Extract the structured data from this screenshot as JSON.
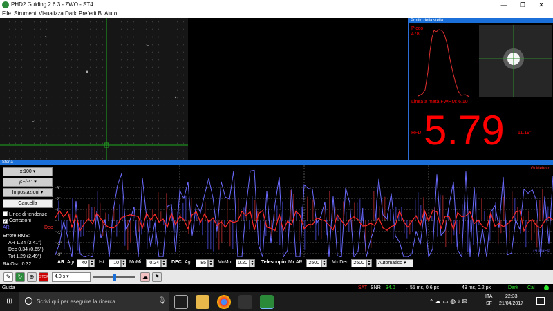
{
  "window": {
    "title": "PHD2 Guiding 2.6.3 - ZWO - ST4",
    "minimize": "—",
    "maximize": "❐",
    "close": "✕"
  },
  "menu": [
    "File",
    "Strumenti",
    "Visualizza",
    "Dark",
    "PreferitiB",
    "Aiuto"
  ],
  "profile": {
    "header": "Profilo della stella",
    "peak_label": "Picco",
    "peak_value": "478",
    "fwhm": "Linea a metà FWHM: 6.10",
    "hfd_label": "HFD",
    "hfd_value": "5.79",
    "hfd_arcsec": "11.19\"",
    "colors": {
      "text": "#ff0000",
      "curve": "#e03030"
    }
  },
  "history": {
    "header": "Storia",
    "x_scale": "x:100",
    "y_scale": "y:+/-4\"",
    "settings": "Impostazioni",
    "cancel": "Cancella",
    "trend_lines": "Linee di tendenze",
    "corrections": "Correzioni",
    "ar_label": "AR",
    "dec_label": "Dec",
    "rms_title": "Errore RMS:",
    "rms_ar": "AR 1.24 (2.41\")",
    "rms_dec": "Dec 0.34 (0.65\")",
    "rms_tot": "Tot 1.29 (2.49\")",
    "ra_osc": "RA Osc: 0.32",
    "legend_right_top": "Guidehord",
    "legend_right_bottom": "GuidaEst",
    "y_ticks": [
      "3\"",
      "2\"",
      "1\"",
      "-1\"",
      "-2\"",
      "-3\""
    ],
    "colors": {
      "ra": "#6b6bff",
      "dec": "#ff2a2a"
    }
  },
  "params": {
    "ar": "AR:",
    "agr": "Agr",
    "agr_val": "40",
    "ist": "Ist",
    "ist_val": "10",
    "momi": "MoMi",
    "momi_val": "0.24",
    "dec": "DEC:",
    "dec_agr": "Agr",
    "dec_agr_val": "85",
    "mnmo": "MnMo",
    "mnmo_val": "0.20",
    "tel": "Telescopio:",
    "mxar": "Mx AR",
    "mxar_val": "2500",
    "mxdec": "Mx Dec",
    "mxdec_val": "2500",
    "mode": "Automatico"
  },
  "toolbar": {
    "exposure": "4.0 s"
  },
  "status": {
    "guiding": "Guida",
    "sat": "SAT",
    "snr_label": "SNR",
    "snr_value": "34.0",
    "ra_pulse": "55 ms, 0.6 px",
    "dec_pulse": "49 ms, 0.2 px",
    "dark": "Dark",
    "cal": "Cal"
  },
  "taskbar": {
    "search_placeholder": "Scrivi qui per eseguire la ricerca",
    "lang": "ITA",
    "lang2": "SF",
    "time": "22:33",
    "date": "21/04/2017"
  }
}
